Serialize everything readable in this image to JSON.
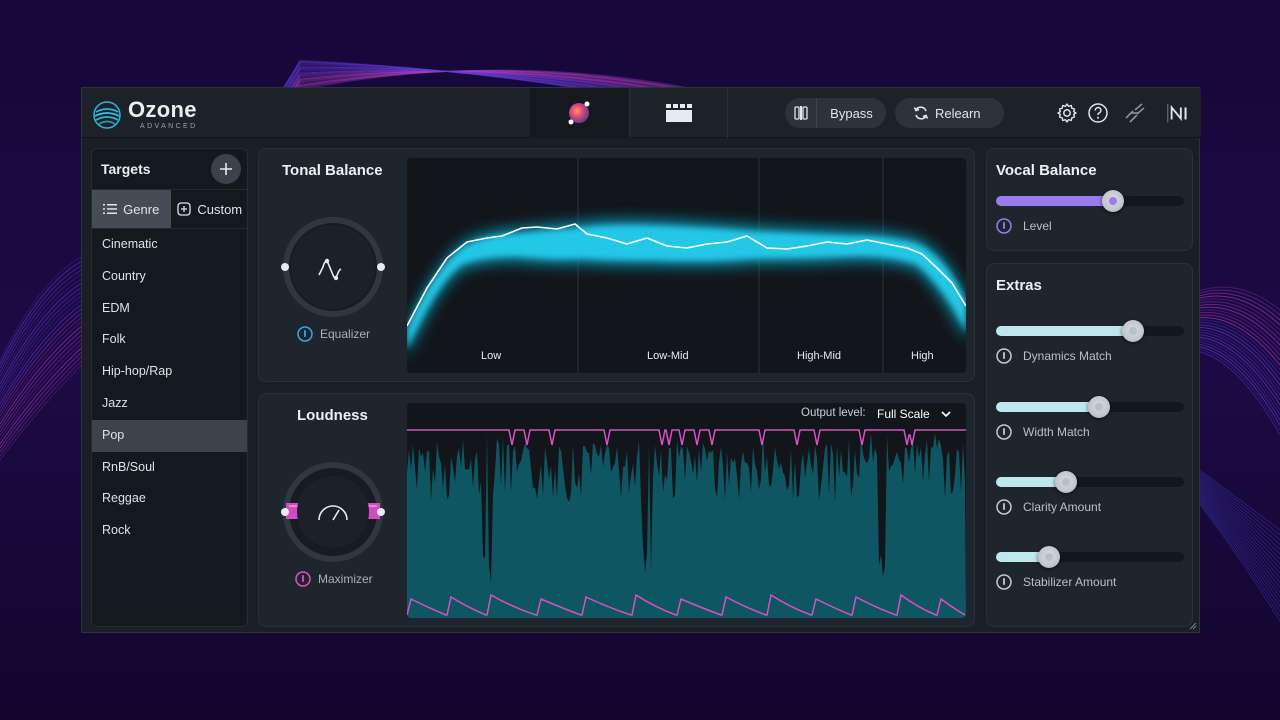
{
  "app": {
    "name": "Ozone",
    "edition": "ADVANCED"
  },
  "toolbar": {
    "bypass_label": "Bypass",
    "relearn_label": "Relearn"
  },
  "targets": {
    "title": "Targets",
    "tabs": [
      {
        "label": "Genre",
        "active": true
      },
      {
        "label": "Custom",
        "active": false
      }
    ],
    "genres": [
      "Cinematic",
      "Country",
      "EDM",
      "Folk",
      "Hip-hop/Rap",
      "Jazz",
      "Pop",
      "RnB/Soul",
      "Reggae",
      "Rock"
    ],
    "selected_genre": "Pop"
  },
  "tonal_balance": {
    "title": "Tonal Balance",
    "module_label": "Equalizer",
    "bands": [
      "Low",
      "Low-Mid",
      "High-Mid",
      "High"
    ]
  },
  "loudness": {
    "title": "Loudness",
    "module_label": "Maximizer",
    "output_label": "Output level:",
    "output_value": "Full Scale"
  },
  "vocal_balance": {
    "title": "Vocal Balance",
    "level_label": "Level",
    "level_value": 0.62
  },
  "extras": {
    "title": "Extras",
    "sliders": [
      {
        "label": "Dynamics Match",
        "value": 0.73
      },
      {
        "label": "Width Match",
        "value": 0.55
      },
      {
        "label": "Clarity Amount",
        "value": 0.37
      },
      {
        "label": "Stabilizer Amount",
        "value": 0.28
      }
    ]
  },
  "colors": {
    "accent_cyan": "#2ad4f0",
    "accent_pink": "#e04fc8",
    "accent_purple": "#9b7cf0",
    "power_blue": "#3aa6e8"
  }
}
